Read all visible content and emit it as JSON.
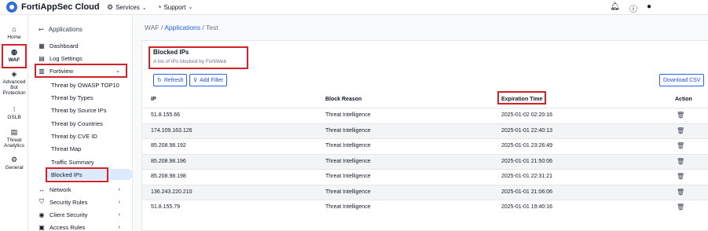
{
  "topbar": {
    "brand": "FortiAppSec Cloud",
    "services": "Services",
    "support": "Support"
  },
  "rail": [
    {
      "label": "Home",
      "icon": "home-icon"
    },
    {
      "label": "WAF",
      "icon": "globe-icon"
    },
    {
      "label": "Advanced Bot Protection",
      "icon": "bot-icon"
    },
    {
      "label": "GSLB",
      "icon": "gslb-icon"
    },
    {
      "label": "Threat Analytics",
      "icon": "analytics-icon"
    },
    {
      "label": "General",
      "icon": "cogs-icon"
    }
  ],
  "sidebar": {
    "back_label": "Applications",
    "items": {
      "dashboard": "Dashboard",
      "log_settings": "Log Settings",
      "fortiview": "Fortiview",
      "network": "Network",
      "security_rules": "Security Rules",
      "client_security": "Client Security",
      "access_rules": "Access Rules"
    },
    "fortiview_children": [
      "Threat by OWASP TOP10",
      "Threat by Types",
      "Threat by Source IPs",
      "Threat by Countries",
      "Threat by CVE ID",
      "Threat Map",
      "Traffic Summary",
      "Blocked IPs"
    ]
  },
  "breadcrumb": {
    "root": "WAF",
    "sep1": " / ",
    "link": "Applications",
    "sep2": " / ",
    "current": "Test"
  },
  "card": {
    "title": "Blocked IPs",
    "subtitle": "A list of IPs blocked by FortiWeb",
    "refresh": "Refresh",
    "add_filter": "Add Filter",
    "download_csv": "Download CSV"
  },
  "table": {
    "columns": [
      "IP",
      "Block Reason",
      "Expiration Time",
      "Action"
    ],
    "rows": [
      {
        "ip": "51.8.155.66",
        "reason": "Threat Intelligence",
        "expires": "2025-01-02 02:20:16"
      },
      {
        "ip": "174.109.163.126",
        "reason": "Threat Intelligence",
        "expires": "2025-01-01 22:40:13"
      },
      {
        "ip": "85.208.98.192",
        "reason": "Threat Intelligence",
        "expires": "2025-01-01 23:26:49"
      },
      {
        "ip": "85.208.98.196",
        "reason": "Threat Intelligence",
        "expires": "2025-01-01 21:50:06"
      },
      {
        "ip": "85.208.98.198",
        "reason": "Threat Intelligence",
        "expires": "2025-01-01 22:31:21"
      },
      {
        "ip": "136.243.220.210",
        "reason": "Threat Intelligence",
        "expires": "2025-01-01 21:06:06"
      },
      {
        "ip": "51.8.155.79",
        "reason": "Threat Intelligence",
        "expires": "2025-01-01 19:40:16"
      }
    ]
  },
  "colors": {
    "accent": "#2563eb",
    "highlight": "#d62128",
    "selected_bg": "#dbeafe"
  }
}
